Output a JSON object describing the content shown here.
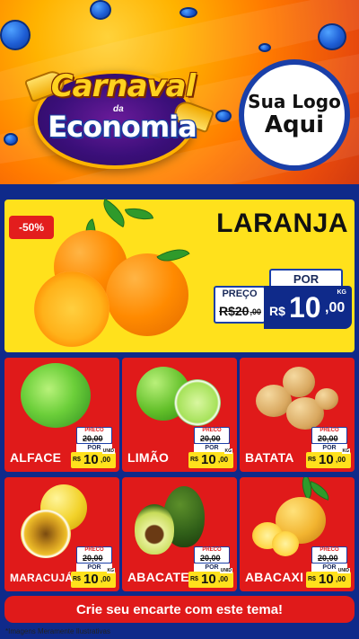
{
  "header": {
    "campaign_line1": "Carnaval",
    "campaign_connector": "da",
    "campaign_line2": "Economia",
    "brand_line1": "Sua Logo",
    "brand_line2": "Aqui"
  },
  "featured": {
    "discount": "-50%",
    "title": "LARANJA",
    "old_label": "PREÇO",
    "old_price_int": "R$20",
    "old_price_cents": ",00",
    "new_label": "POR",
    "currency": "R$",
    "price_int": "10",
    "price_cents": ",00",
    "unit": "KG"
  },
  "products": [
    {
      "name": "ALFACE",
      "old_label": "PRECO",
      "old_price": "20,00",
      "new_label": "POR",
      "currency": "R$",
      "price_int": "10",
      "price_cents": ",00",
      "unit": "UNID"
    },
    {
      "name": "LIMÃO",
      "old_label": "PRECO",
      "old_price": "20,00",
      "new_label": "POR",
      "currency": "R$",
      "price_int": "10",
      "price_cents": ",00",
      "unit": "KG"
    },
    {
      "name": "BATATA",
      "old_label": "PRECO",
      "old_price": "20,00",
      "new_label": "POR",
      "currency": "R$",
      "price_int": "10",
      "price_cents": ",00",
      "unit": "KG"
    },
    {
      "name": "MARACUJÁ",
      "old_label": "PRECO",
      "old_price": "20,00",
      "new_label": "POR",
      "currency": "R$",
      "price_int": "10",
      "price_cents": ",00",
      "unit": "KG"
    },
    {
      "name": "ABACATE",
      "old_label": "PRECO",
      "old_price": "20,00",
      "new_label": "POR",
      "currency": "R$",
      "price_int": "10",
      "price_cents": ",00",
      "unit": "UNID"
    },
    {
      "name": "ABACAXI",
      "old_label": "PRECO",
      "old_price": "20,00",
      "new_label": "POR",
      "currency": "R$",
      "price_int": "10",
      "price_cents": ",00",
      "unit": "UNID"
    }
  ],
  "cta": "Crie seu encarte com este tema!",
  "disclaimer": "*Imagens Meramente Ilustrativas",
  "colors": {
    "accent_red": "#e01a1a",
    "accent_yellow": "#ffe11c",
    "accent_blue": "#0f2a8a"
  }
}
